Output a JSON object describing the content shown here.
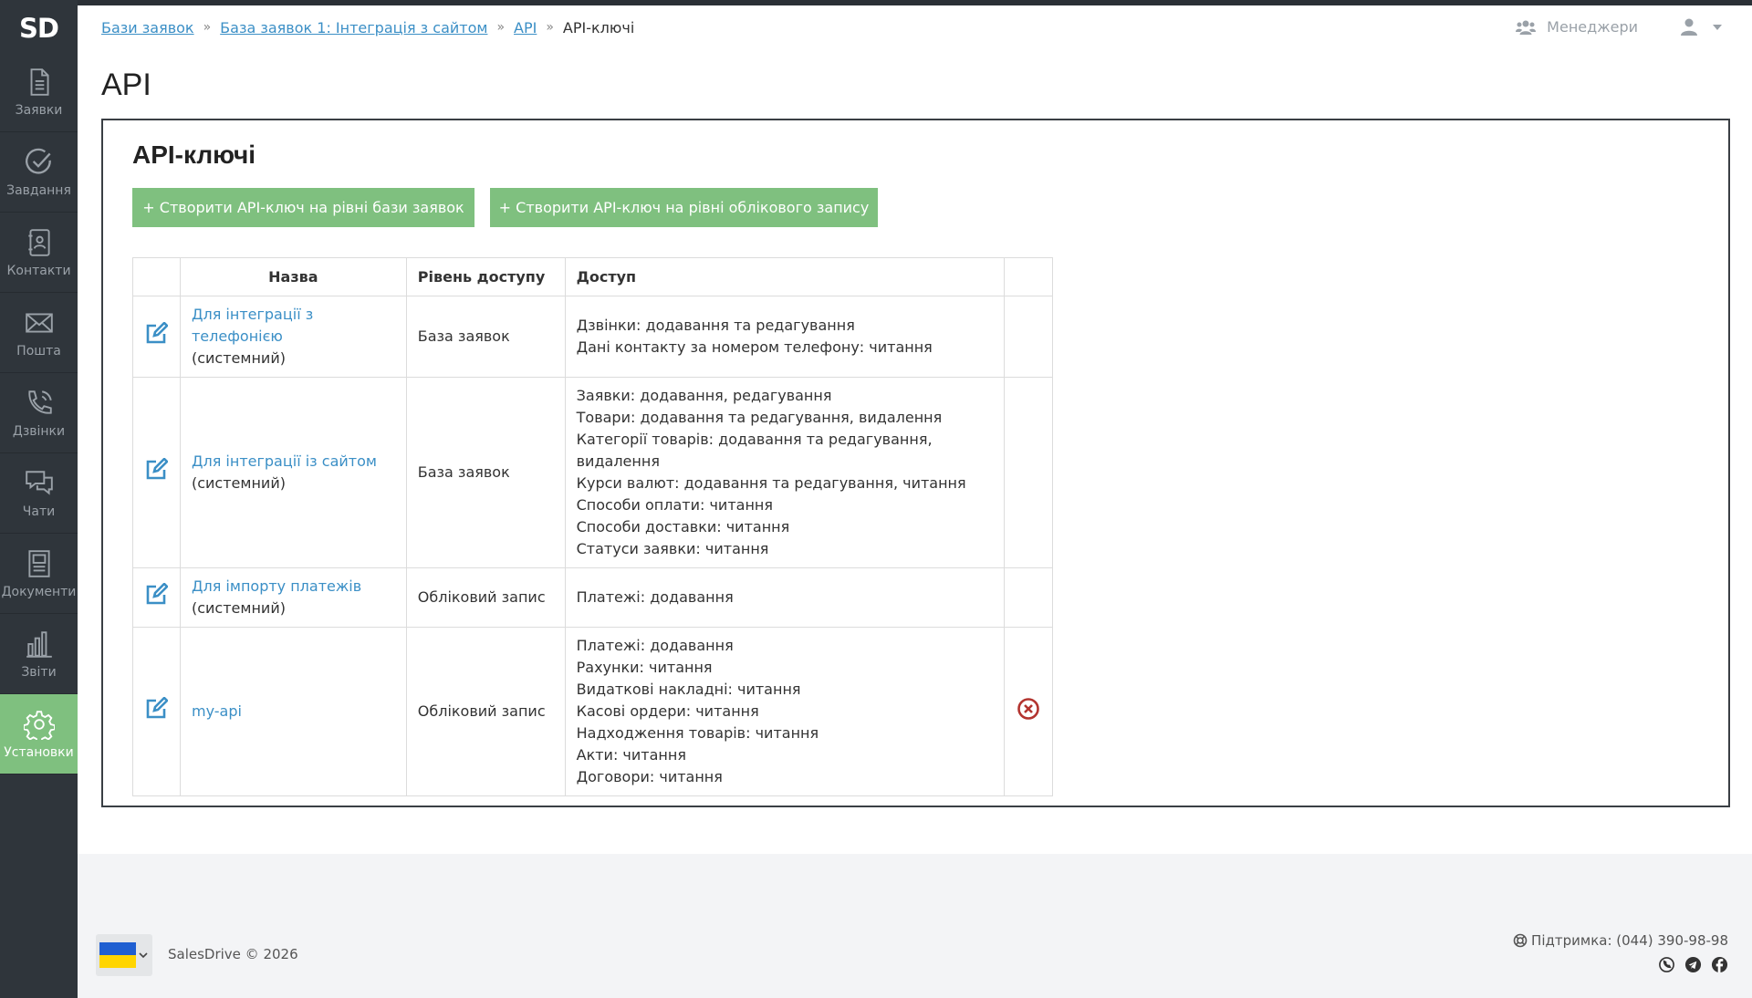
{
  "logo": "SD",
  "sidebar": {
    "items": [
      {
        "label": "Заявки",
        "icon": "document-icon"
      },
      {
        "label": "Завдання",
        "icon": "check-circle-icon"
      },
      {
        "label": "Контакти",
        "icon": "contact-book-icon"
      },
      {
        "label": "Пошта",
        "icon": "envelope-icon"
      },
      {
        "label": "Дзвінки",
        "icon": "phone-icon"
      },
      {
        "label": "Чати",
        "icon": "chat-icon"
      },
      {
        "label": "Документи",
        "icon": "documents-icon"
      },
      {
        "label": "Звіти",
        "icon": "bar-chart-icon"
      },
      {
        "label": "Установки",
        "icon": "gear-icon",
        "active": true
      }
    ]
  },
  "breadcrumb": {
    "items": [
      "Бази заявок",
      "База заявок 1: Інтеграція з сайтом",
      "API"
    ],
    "current": "API-ключі",
    "separator": "»"
  },
  "header": {
    "managers_label": "Менеджери"
  },
  "page": {
    "title": "API"
  },
  "panel": {
    "title": "API-ключі",
    "btn_create_base": "+ Створити API-ключ на рівні бази заявок",
    "btn_create_account": "+ Створити API-ключ на рівні облікового запису"
  },
  "table": {
    "headers": {
      "name": "Назва",
      "level": "Рівень доступу",
      "access": "Доступ"
    },
    "rows": [
      {
        "name": "Для інтеграції з телефонією",
        "note": "(системний)",
        "level": "База заявок",
        "access": [
          "Дзвінки: додавання та редагування",
          "Дані контакту за номером телефону: читання"
        ],
        "deletable": false
      },
      {
        "name": "Для інтеграції із сайтом",
        "note": "(системний)",
        "level": "База заявок",
        "access": [
          "Заявки: додавання, редагування",
          "Товари: додавання та редагування, видалення",
          "Категорії товарів: додавання та редагування, видалення",
          "Курси валют: додавання та редагування, читання",
          "Способи оплати: читання",
          "Способи доставки: читання",
          "Статуси заявки: читання"
        ],
        "deletable": false
      },
      {
        "name": "Для імпорту платежів",
        "note": "(системний)",
        "level": "Обліковий запис",
        "access": [
          "Платежі: додавання"
        ],
        "deletable": false
      },
      {
        "name": "my-api",
        "note": "",
        "level": "Обліковий запис",
        "access": [
          "Платежі: додавання",
          "Рахунки: читання",
          "Видаткові накладні: читання",
          "Касові ордери: читання",
          "Надходження товарів: читання",
          "Акти: читання",
          "Договори: читання"
        ],
        "deletable": true
      }
    ]
  },
  "footer": {
    "copyright": "SalesDrive © 2026",
    "support": "Підтримка: (044) 390-98-98"
  },
  "colors": {
    "sidebar_bg": "#2f353b",
    "accent_green": "#7fc07f",
    "link_blue": "#3b8fc6",
    "delete_red": "#b3342f"
  }
}
